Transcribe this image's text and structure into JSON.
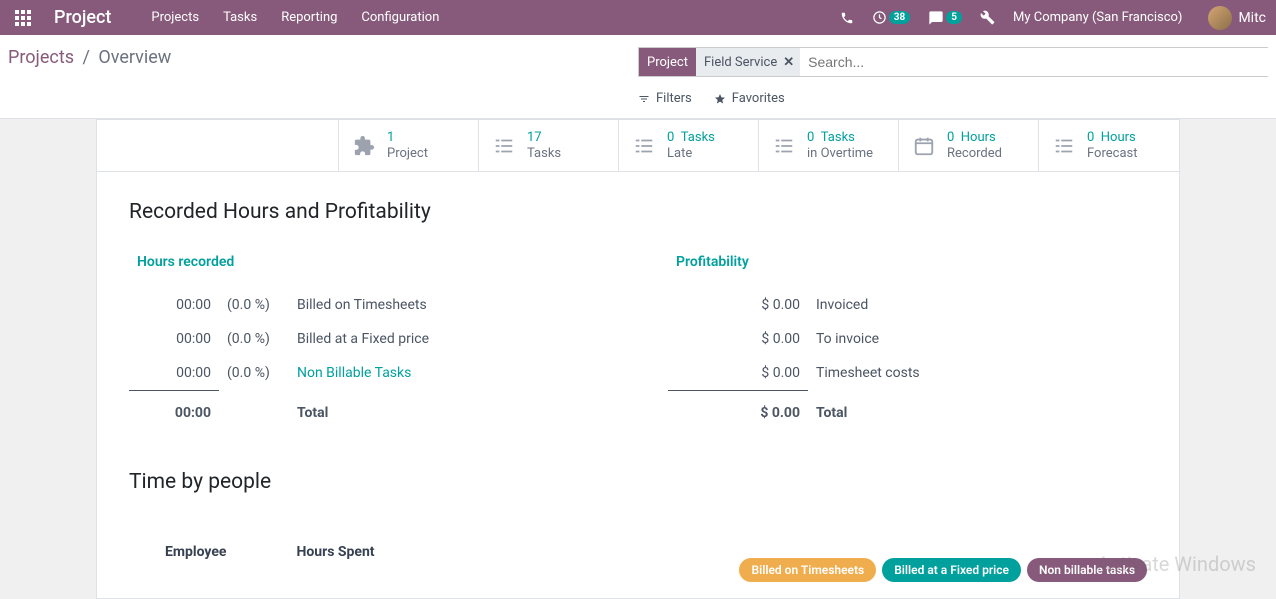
{
  "header": {
    "brand": "Project",
    "nav": [
      "Projects",
      "Tasks",
      "Reporting",
      "Configuration"
    ],
    "badge_activities": "38",
    "badge_messages": "5",
    "company": "My Company (San Francisco)",
    "user": "Mitc"
  },
  "breadcrumb": {
    "parent": "Projects",
    "current": "Overview"
  },
  "search": {
    "facet_name": "Project",
    "facet_value": "Field Service",
    "placeholder": "Search...",
    "filters_label": "Filters",
    "favorites_label": "Favorites"
  },
  "stats": [
    {
      "top": "1",
      "top2": "",
      "bottom": "Project"
    },
    {
      "top": "17",
      "top2": "",
      "bottom": "Tasks"
    },
    {
      "top": "0",
      "top2": "Tasks",
      "bottom": "Late"
    },
    {
      "top": "0",
      "top2": "Tasks",
      "bottom": "in Overtime"
    },
    {
      "top": "0",
      "top2": "Hours",
      "bottom": "Recorded"
    },
    {
      "top": "0",
      "top2": "Hours",
      "bottom": "Forecast"
    }
  ],
  "section_title": "Recorded Hours and Profitability",
  "hours": {
    "title": "Hours recorded",
    "rows": [
      {
        "time": "00:00",
        "pct": "(0.0 %)",
        "label": "Billed on Timesheets",
        "link": false
      },
      {
        "time": "00:00",
        "pct": "(0.0 %)",
        "label": "Billed at a Fixed price",
        "link": false
      },
      {
        "time": "00:00",
        "pct": "(0.0 %)",
        "label": "Non Billable Tasks",
        "link": true
      }
    ],
    "total_time": "00:00",
    "total_label": "Total"
  },
  "profit": {
    "title": "Profitability",
    "rows": [
      {
        "amount": "$ 0.00",
        "label": "Invoiced"
      },
      {
        "amount": "$ 0.00",
        "label": "To invoice"
      },
      {
        "amount": "$ 0.00",
        "label": "Timesheet costs"
      }
    ],
    "total_amount": "$ 0.00",
    "total_label": "Total"
  },
  "time_by_people": {
    "title": "Time by people",
    "pills": [
      "Billed on Timesheets",
      "Billed at a Fixed price",
      "Non billable tasks"
    ],
    "columns": [
      "Employee",
      "Hours Spent"
    ]
  },
  "watermark": "Activate Windows"
}
